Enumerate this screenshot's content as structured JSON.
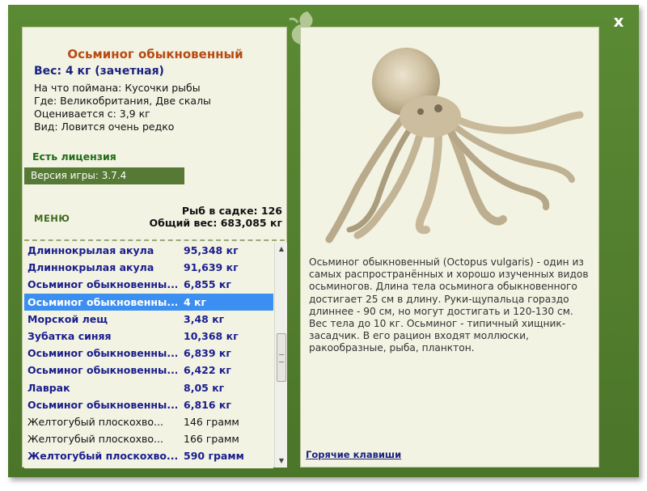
{
  "window": {
    "close_label": "x"
  },
  "fish": {
    "name": "Осьминог обыкновенный",
    "weight": "Вес: 4 кг (зачетная)",
    "info": [
      "На что поймана: Кусочки рыбы",
      "Где: Великобритания, Две скалы",
      "Оценивается с: 3,9 кг",
      "Вид: Ловится очень редко"
    ],
    "license": "Есть лицензия",
    "description": "Осьминог обыкновенный (Octopus vulgaris) - один из самых распространённых и хорошо изученных видов осьминогов. Длина тела осьминога обыкновенного достигает 25 см в длину. Руки-щупальца гораздо длиннее - 90 см, но могут достигать и 120-130 см. Вес тела до 10 кг. Осьминог - типичный хищник-засадчик. В его рацион входят моллюски, ракообразные, рыба, планктон."
  },
  "game": {
    "version": "Версия игры: 3.7.4",
    "menu_label": "МЕНЮ"
  },
  "stats": {
    "fish_count": "Рыб в садке: 126",
    "total_weight": "Общий вес: 683,085 кг"
  },
  "catch_list": [
    {
      "name": "Длиннокрылая акула",
      "weight": "95,348 кг",
      "style": "bold"
    },
    {
      "name": "Длиннокрылая акула",
      "weight": "91,639 кг",
      "style": "bold"
    },
    {
      "name": "Осьминог обыкновенны...",
      "weight": "6,855 кг",
      "style": "bold"
    },
    {
      "name": "Осьминог обыкновенны...",
      "weight": "4 кг",
      "style": "sel"
    },
    {
      "name": "Морской лещ",
      "weight": "3,48 кг",
      "style": "bold"
    },
    {
      "name": "Зубатка синяя",
      "weight": "10,368 кг",
      "style": "bold"
    },
    {
      "name": "Осьминог обыкновенны...",
      "weight": "6,839 кг",
      "style": "bold"
    },
    {
      "name": "Осьминог обыкновенны...",
      "weight": "6,422 кг",
      "style": "bold"
    },
    {
      "name": "Лаврак",
      "weight": "8,05 кг",
      "style": "bold"
    },
    {
      "name": "Осьминог обыкновенны...",
      "weight": "6,816 кг",
      "style": "bold"
    },
    {
      "name": "Желтогубый плоскохво...",
      "weight": "146 грамм",
      "style": "norm"
    },
    {
      "name": "Желтогубый плоскохво...",
      "weight": "166 грамм",
      "style": "norm"
    },
    {
      "name": "Желтогубый плоскохво...",
      "weight": "590 грамм",
      "style": "bold"
    }
  ],
  "links": {
    "hotkeys": "Горячие клавиши"
  },
  "colors": {
    "frame": "#4f7d2c",
    "panel": "#f3f3e4",
    "selection": "#3b8ff0",
    "title": "#b84a12",
    "bold_text": "#1a1e8c"
  }
}
